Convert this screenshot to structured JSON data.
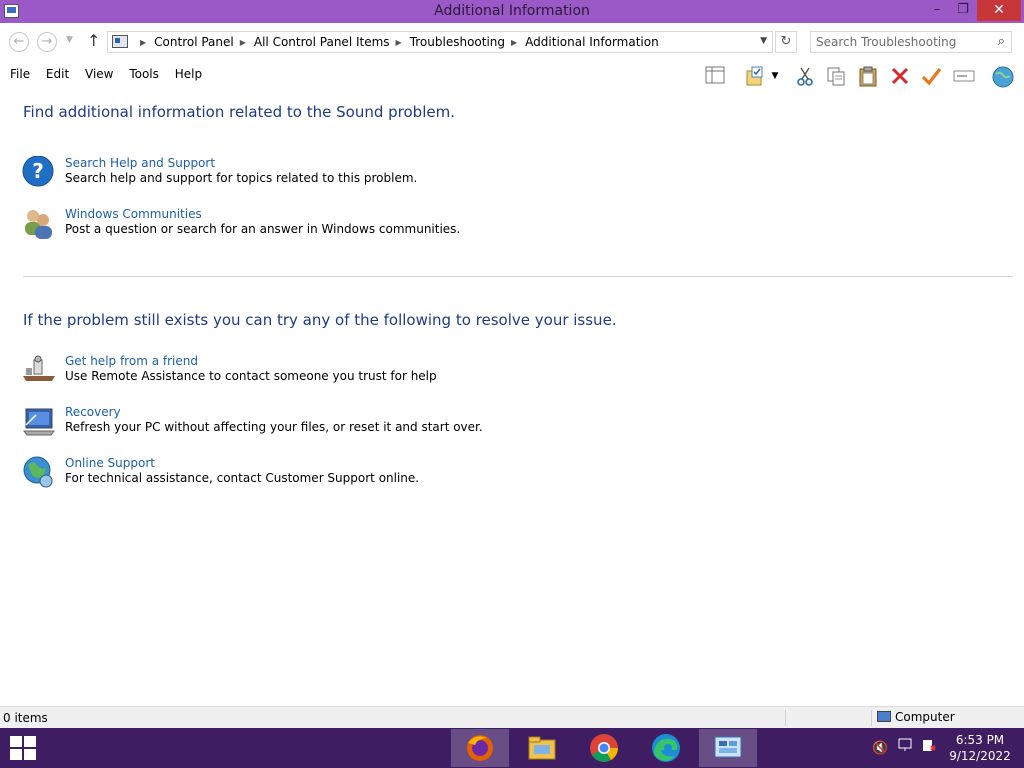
{
  "window": {
    "title": "Additional Information",
    "min_glyph": "–",
    "max_glyph": "❐",
    "close_glyph": "✕"
  },
  "nav": {
    "back_glyph": "←",
    "forward_glyph": "→",
    "dropdown_glyph": "▼",
    "up_glyph": "↑",
    "breadcrumbs": [
      "Control Panel",
      "All Control Panel Items",
      "Troubleshooting",
      "Additional Information"
    ],
    "crumb_sep": "▶",
    "refresh_glyph": "↻",
    "search_placeholder": "Search Troubleshooting",
    "search_glyph": "⌕"
  },
  "menu": [
    "File",
    "Edit",
    "View",
    "Tools",
    "Help"
  ],
  "toolbar": {
    "icons": [
      "layout-icon",
      "properties-icon",
      "cut-icon",
      "copy-icon",
      "paste-icon",
      "delete-icon",
      "checkmark-icon",
      "rename-icon",
      "globe-icon"
    ]
  },
  "section1": {
    "heading": "Find additional information related to the Sound problem.",
    "items": [
      {
        "link": "Search Help and Support",
        "desc": "Search help and support for topics related to this problem.",
        "icon": "help-icon"
      },
      {
        "link": "Windows Communities",
        "desc": "Post a question or search for an answer in Windows communities.",
        "icon": "users-icon"
      }
    ]
  },
  "section2": {
    "heading": "If the problem still exists you can try any of the following to resolve your issue.",
    "items": [
      {
        "link": "Get help from a friend",
        "desc": "Use Remote Assistance to contact someone you trust for help",
        "icon": "remote-assistance-icon"
      },
      {
        "link": "Recovery",
        "desc": "Refresh your PC without affecting your files, or reset it and start over.",
        "icon": "recovery-icon"
      },
      {
        "link": "Online Support",
        "desc": "For technical assistance, contact Customer Support online.",
        "icon": "online-support-icon"
      }
    ]
  },
  "status": {
    "count": "0 items",
    "location": "Computer"
  },
  "taskbar": {
    "apps": [
      "firefox-icon",
      "file-explorer-icon",
      "chrome-icon",
      "edge-icon",
      "control-panel-icon"
    ],
    "time": "6:53 PM",
    "date": "9/12/2022"
  },
  "colors": {
    "titlebar": "#9a59c7",
    "taskbar": "#3e1d63",
    "heading": "#1e3a8a",
    "link": "#1c5fa8",
    "close": "#c7373a"
  }
}
